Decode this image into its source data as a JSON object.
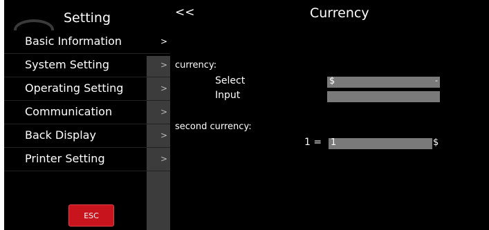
{
  "sidebar": {
    "title": "Setting",
    "items": [
      {
        "label": "Basic Information",
        "chevron": ">"
      },
      {
        "label": "System Setting",
        "chevron": ">"
      },
      {
        "label": "Operating Setting",
        "chevron": ">"
      },
      {
        "label": "Communication",
        "chevron": ">"
      },
      {
        "label": "Back Display",
        "chevron": ">"
      },
      {
        "label": "Printer Setting",
        "chevron": ">"
      }
    ],
    "esc_label": "ESC"
  },
  "header": {
    "back_label": "<<",
    "title": "Currency"
  },
  "currency": {
    "section_label": "currency:",
    "select_label": "Select",
    "select_value": "$",
    "select_arrow": "-",
    "input_label": "Input",
    "input_value": ""
  },
  "second_currency": {
    "section_label": "second currency:",
    "equals_label": "1 =",
    "rate_value": "1",
    "unit": "$"
  },
  "colors": {
    "background": "#000000",
    "esc": "#c8141c",
    "field": "#7a7a7a",
    "rail": "#3c3c3c"
  }
}
